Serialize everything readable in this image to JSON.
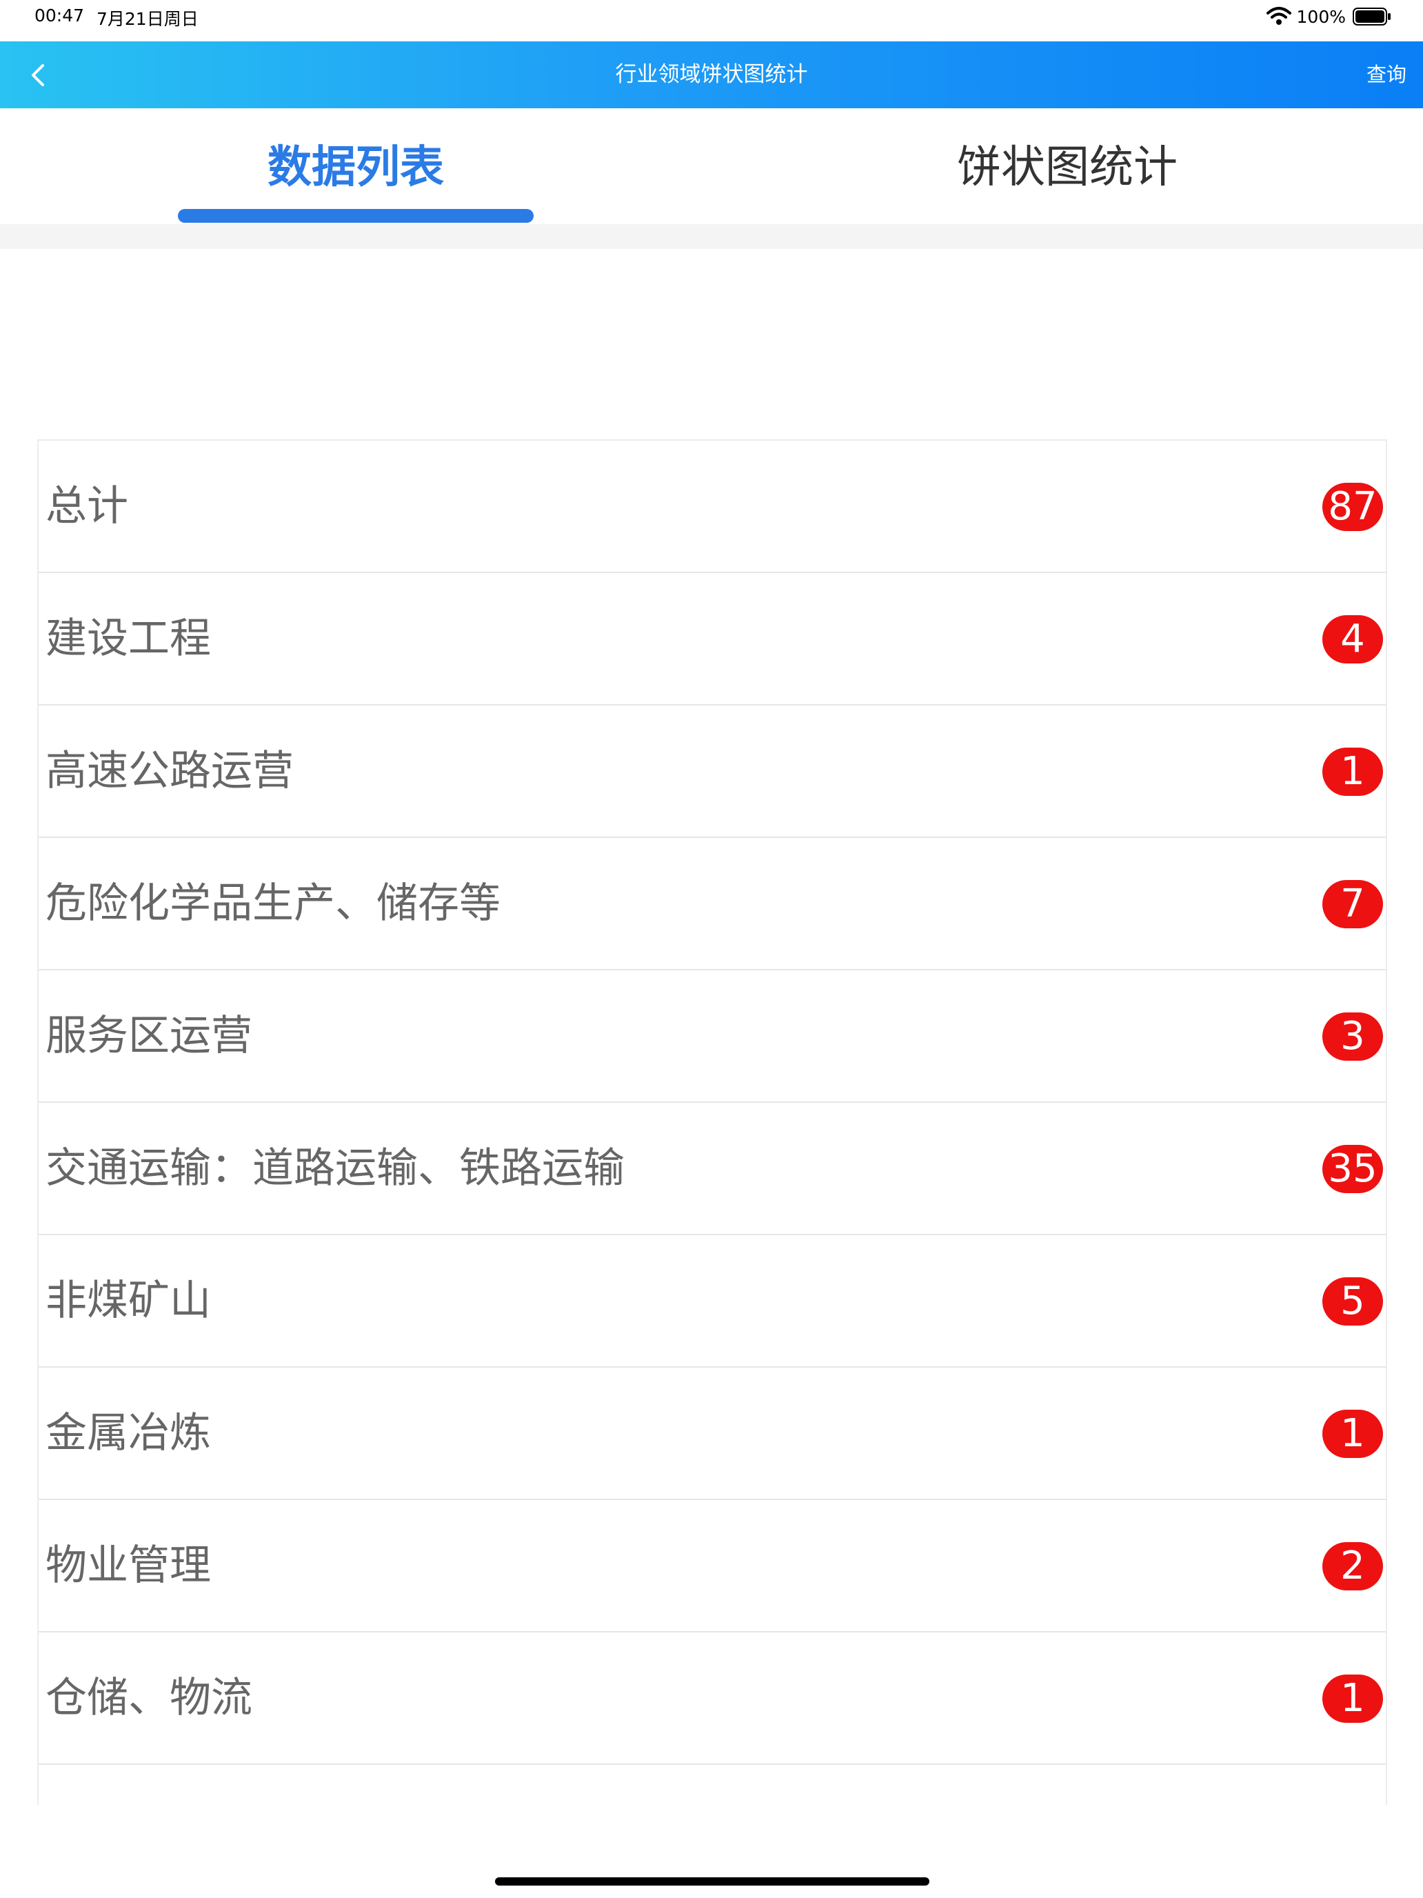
{
  "status_bar": {
    "time": "00:47",
    "date": "7月21日周日",
    "battery": "100%",
    "icons": [
      "wifi-icon",
      "battery-icon"
    ]
  },
  "nav": {
    "back_icon": "chevron-left-icon",
    "title": "行业领域饼状图统计",
    "query_label": "查询"
  },
  "tabs": [
    {
      "label": "数据列表",
      "active": true
    },
    {
      "label": "饼状图统计",
      "active": false
    }
  ],
  "colors": {
    "accent": "#2b7be6",
    "badge": "#ee1111",
    "nav_gradient_start": "#29c2f2",
    "nav_gradient_end": "#0a7ff6"
  },
  "list": {
    "items": [
      {
        "label": "总计",
        "count": "87"
      },
      {
        "label": "建设工程",
        "count": "4"
      },
      {
        "label": "高速公路运营",
        "count": "1"
      },
      {
        "label": "危险化学品生产、储存等",
        "count": "7"
      },
      {
        "label": "服务区运营",
        "count": "3"
      },
      {
        "label": "交通运输：道路运输、铁路运输",
        "count": "35"
      },
      {
        "label": "非煤矿山",
        "count": "5"
      },
      {
        "label": "金属冶炼",
        "count": "1"
      },
      {
        "label": "物业管理",
        "count": "2"
      },
      {
        "label": "仓储、物流",
        "count": "1"
      }
    ]
  }
}
